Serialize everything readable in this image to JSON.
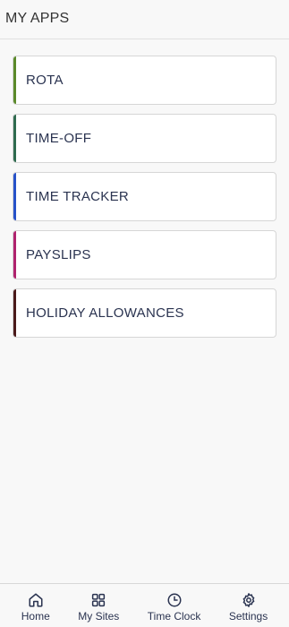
{
  "header": {
    "title": "MY APPS"
  },
  "apps": [
    {
      "label": "ROTA",
      "accent": "#5b8a2a"
    },
    {
      "label": "TIME-OFF",
      "accent": "#2f6b4f"
    },
    {
      "label": "TIME TRACKER",
      "accent": "#2752c9"
    },
    {
      "label": "PAYSLIPS",
      "accent": "#b0236e"
    },
    {
      "label": "HOLIDAY ALLOWANCES",
      "accent": "#4a1a1a"
    }
  ],
  "nav": {
    "home": {
      "label": "Home",
      "icon": "home-icon"
    },
    "my_sites": {
      "label": "My Sites",
      "icon": "grid-icon"
    },
    "time_clock": {
      "label": "Time Clock",
      "icon": "clock-icon"
    },
    "settings": {
      "label": "Settings",
      "icon": "gear-icon"
    }
  }
}
